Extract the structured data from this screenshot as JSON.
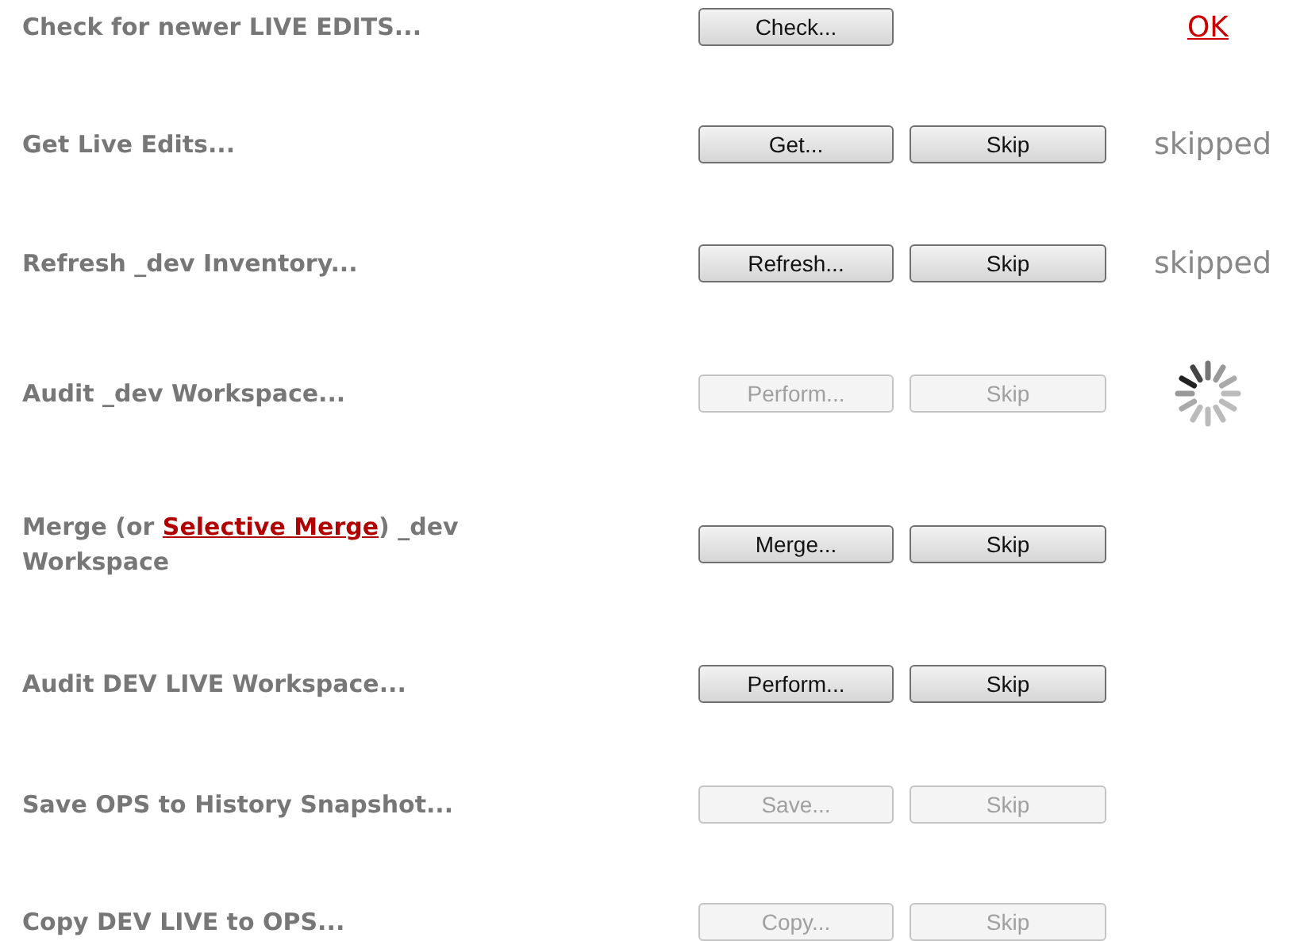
{
  "steps": [
    {
      "label": "Check for newer LIVE EDITS...",
      "buttons": [
        {
          "label": "Check...",
          "disabled": false
        }
      ],
      "status": {
        "kind": "link",
        "text": "OK"
      }
    },
    {
      "label": "Get Live Edits...",
      "buttons": [
        {
          "label": "Get...",
          "disabled": false
        },
        {
          "label": "Skip",
          "disabled": false
        }
      ],
      "status": {
        "kind": "text",
        "text": "skipped"
      }
    },
    {
      "label": "Refresh _dev Inventory...",
      "buttons": [
        {
          "label": "Refresh...",
          "disabled": false
        },
        {
          "label": "Skip",
          "disabled": false
        }
      ],
      "status": {
        "kind": "text",
        "text": "skipped"
      }
    },
    {
      "label": "Audit _dev Workspace...",
      "buttons": [
        {
          "label": "Perform...",
          "disabled": true
        },
        {
          "label": "Skip",
          "disabled": true
        }
      ],
      "status": {
        "kind": "spinner"
      }
    },
    {
      "label": "Merge (or ",
      "link": "Selective Merge",
      "label_after": ") _dev Workspace",
      "buttons": [
        {
          "label": "Merge...",
          "disabled": false
        },
        {
          "label": "Skip",
          "disabled": false
        }
      ]
    },
    {
      "label": "Audit DEV LIVE Workspace...",
      "buttons": [
        {
          "label": "Perform...",
          "disabled": false
        },
        {
          "label": "Skip",
          "disabled": false
        }
      ]
    },
    {
      "label": "Save OPS to History Snapshot...",
      "buttons": [
        {
          "label": "Save...",
          "disabled": true
        },
        {
          "label": "Skip",
          "disabled": true
        }
      ]
    },
    {
      "label": "Copy DEV LIVE to OPS...",
      "buttons": [
        {
          "label": "Copy...",
          "disabled": true
        },
        {
          "label": "Skip",
          "disabled": true
        }
      ]
    }
  ]
}
